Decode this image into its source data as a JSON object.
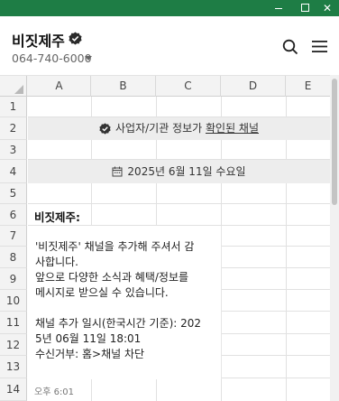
{
  "window": {
    "min_glyph": "",
    "max_glyph": "",
    "close_glyph": "✕",
    "titlebar_color": "#1e7d45"
  },
  "header": {
    "channel_name": "비짓제주",
    "phone": "064-740-6000",
    "verified_icon": "verified-check-icon",
    "search_icon": "search-icon",
    "menu_icon": "hamburger-menu-icon"
  },
  "sheet": {
    "columns": [
      "A",
      "B",
      "C",
      "D",
      "E"
    ],
    "rows": [
      "1",
      "2",
      "3",
      "4",
      "5",
      "6",
      "7",
      "8",
      "9",
      "10",
      "11",
      "12",
      "13",
      "14"
    ]
  },
  "chat": {
    "verified_notice_prefix": "사업자/기관 정보가 ",
    "verified_notice_link": "확인된 채널",
    "date": "2025년 6월 11일 수요일",
    "sender": "비짓제주:",
    "message_lines": [
      "'비짓제주' 채널을 추가해 주셔서 감",
      "사합니다.",
      "앞으로 다양한 소식과 혜택/정보를",
      "메시지로 받으실 수 있습니다.",
      "",
      "채널 추가 일시(한국시간 기준): 202",
      "5년 06월 11일 18:01",
      "수신거부: 홈>채널 차단"
    ],
    "time": "오후 6:01"
  }
}
